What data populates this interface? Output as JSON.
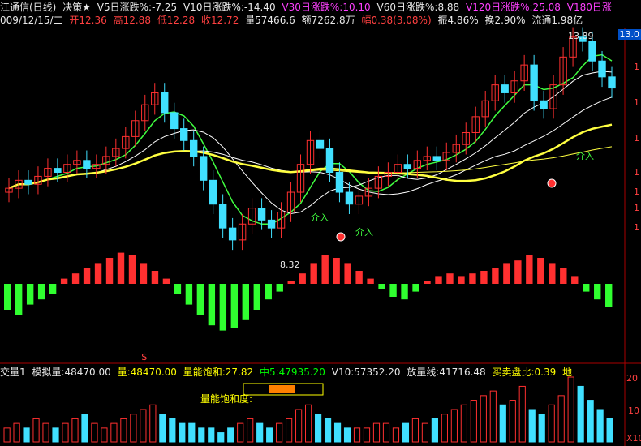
{
  "header": {
    "title": "江通信(日线)",
    "strategy": "决策★",
    "v5": "V5日涨跌%:-7.25",
    "v10": "V10日涨跌%:-14.40",
    "v30": "V30日涨跌%:10.10",
    "v60": "V60日涨跌%:8.88",
    "v120": "V120日涨跌%:25.08",
    "v180": "V180日涨"
  },
  "quote": {
    "date": "009/12/15/二",
    "open": "开12.36",
    "high": "高12.88",
    "low": "低12.28",
    "close": "收12.72",
    "volume": "量57466.6",
    "amount": "额7262.8万",
    "change": "幅0.38(3.08%)",
    "amplitude": "振4.86%",
    "turnover": "换2.90%",
    "float": "流通1.98亿"
  },
  "price_tag": "13.0",
  "annotations": {
    "high_label": "13.89",
    "low_label": "8.32",
    "entry1": "介入",
    "entry2": "介入",
    "entry3": "介入",
    "sat_label": "量能饱和度:",
    "dollar": "$"
  },
  "right_axis": [
    "1",
    "1",
    "1",
    "1",
    "1",
    "1",
    "1"
  ],
  "indicator": {
    "name": "交量1",
    "sim_vol": "模拟量:48470.00",
    "vol": "量:48470.00",
    "saturation": "量能饱和:27.82",
    "mid5": "中5:47935.20",
    "v10": "V10:57352.20",
    "release": "放量线:41716.48",
    "ratio": "买卖盘比:0.39",
    "land": "地",
    "axis_20": "20",
    "axis_10": "10",
    "axis_x10": "X10"
  },
  "colors": {
    "up": "#ff3030",
    "down": "#40e0ff",
    "ma_yellow": "#ffff40",
    "ma_green": "#40ff40",
    "bg": "#000000"
  },
  "chart_data": {
    "type": "line",
    "title": "江通信(日线)",
    "price_series": {
      "name": "close",
      "values": [
        10.2,
        10.4,
        10.3,
        10.5,
        10.7,
        10.6,
        10.8,
        10.9,
        10.7,
        10.8,
        11.0,
        11.2,
        11.5,
        11.9,
        12.3,
        12.6,
        12.1,
        11.7,
        11.4,
        11.0,
        10.4,
        9.8,
        9.2,
        8.9,
        9.3,
        9.7,
        9.4,
        9.2,
        9.6,
        10.1,
        10.8,
        11.4,
        11.2,
        10.6,
        10.1,
        9.8,
        10.0,
        10.2,
        10.5,
        10.6,
        10.8,
        10.7,
        10.9,
        11.0,
        10.9,
        11.1,
        11.3,
        11.6,
        12.0,
        12.4,
        12.8,
        12.6,
        12.9,
        13.3,
        12.4,
        12.2,
        12.8,
        13.5,
        14.0,
        13.89,
        13.4,
        13.0,
        12.72
      ],
      "max": 13.89,
      "min": 8.32
    },
    "macd_hist": [
      -1,
      -1.2,
      -0.8,
      -0.6,
      -0.4,
      0.2,
      0.4,
      0.6,
      0.8,
      1.0,
      1.2,
      1.1,
      0.8,
      0.5,
      0.2,
      -0.4,
      -0.8,
      -1.2,
      -1.6,
      -1.8,
      -1.7,
      -1.4,
      -1.0,
      -0.6,
      -0.3,
      0.1,
      0.4,
      0.8,
      1.1,
      1.0,
      0.8,
      0.5,
      0.2,
      -0.2,
      -0.5,
      -0.6,
      -0.3,
      0.1,
      0.3,
      0.4,
      0.3,
      0.4,
      0.5,
      0.6,
      0.8,
      0.9,
      1.1,
      1.0,
      0.8,
      0.6,
      0.3,
      -0.3,
      -0.6,
      -0.9
    ],
    "volume": [
      3,
      4,
      3,
      5,
      4,
      3,
      4,
      5,
      6,
      4,
      3,
      4,
      5,
      6,
      7,
      8,
      6,
      5,
      4,
      4,
      3,
      3,
      2,
      3,
      4,
      5,
      4,
      3,
      4,
      5,
      7,
      8,
      6,
      5,
      4,
      3,
      3,
      3,
      4,
      4,
      3,
      4,
      5,
      4,
      5,
      6,
      7,
      8,
      9,
      10,
      11,
      8,
      9,
      12,
      7,
      6,
      8,
      10,
      14,
      12,
      9,
      7,
      5
    ]
  }
}
